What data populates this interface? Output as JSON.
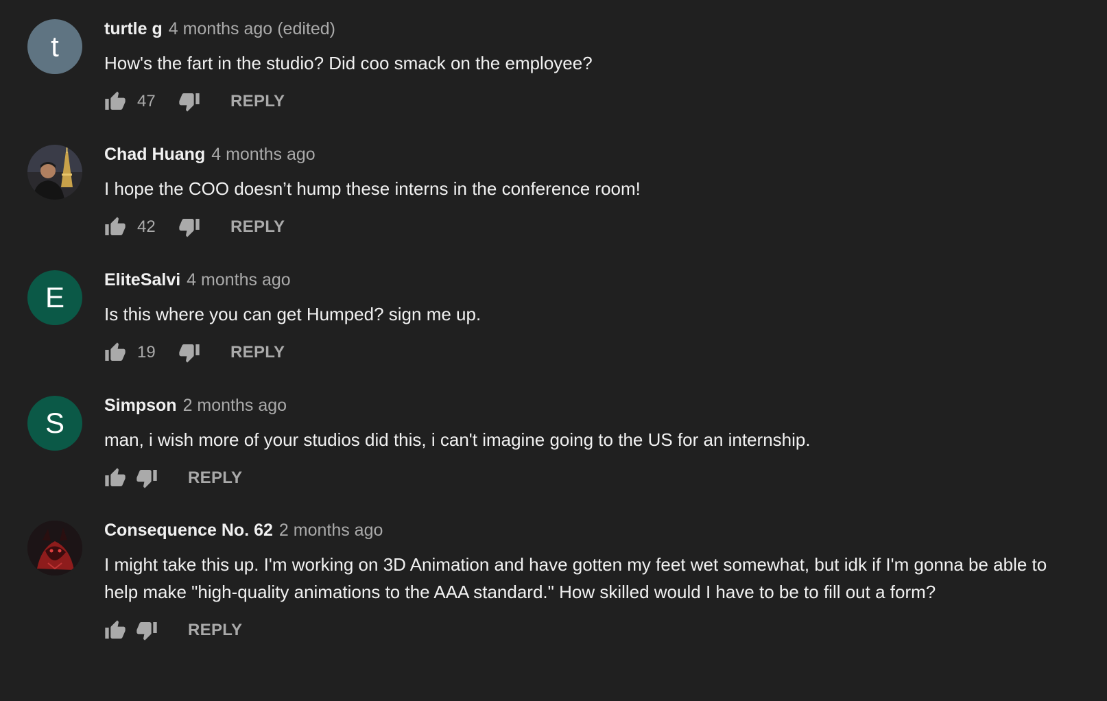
{
  "colors": {
    "background": "#202020",
    "author_text": "#f1f1f1",
    "meta_text": "#aaaaaa",
    "avatar_t": "#5f7482",
    "avatar_e": "#0b5947",
    "avatar_s": "#0b5947"
  },
  "comments": [
    {
      "author": "turtle g",
      "time": "4 months ago",
      "edited": "(edited)",
      "text": "How's the fart in the studio? Did coo smack on the employee?",
      "likes": "47",
      "reply_label": "REPLY",
      "avatar": {
        "type": "initial",
        "initial": "t"
      }
    },
    {
      "author": "Chad Huang",
      "time": "4 months ago",
      "edited": "",
      "text": "I hope the COO doesn’t hump these interns in the conference room!",
      "likes": "42",
      "reply_label": "REPLY",
      "avatar": {
        "type": "photo",
        "icon": "person-eiffel-photo-icon"
      }
    },
    {
      "author": "EliteSalvi",
      "time": "4 months ago",
      "edited": "",
      "text": "Is this where you can get Humped? sign me up.",
      "likes": "19",
      "reply_label": "REPLY",
      "avatar": {
        "type": "initial",
        "initial": "E"
      }
    },
    {
      "author": "Simpson",
      "time": "2 months ago",
      "edited": "",
      "text": "man, i wish more of your studios did this, i can't imagine going to the US for an internship.",
      "likes": "",
      "reply_label": "REPLY",
      "avatar": {
        "type": "initial",
        "initial": "S"
      }
    },
    {
      "author": "Consequence No. 62",
      "time": "2 months ago",
      "edited": "",
      "text": "I might take this up. I'm working on 3D Animation and have gotten my feet wet somewhat, but idk if I'm gonna be able to help make \"high-quality animations to the AAA standard.\" How skilled would I have to be to fill out a form?",
      "likes": "",
      "reply_label": "REPLY",
      "avatar": {
        "type": "art",
        "icon": "red-creature-art-icon"
      }
    }
  ]
}
